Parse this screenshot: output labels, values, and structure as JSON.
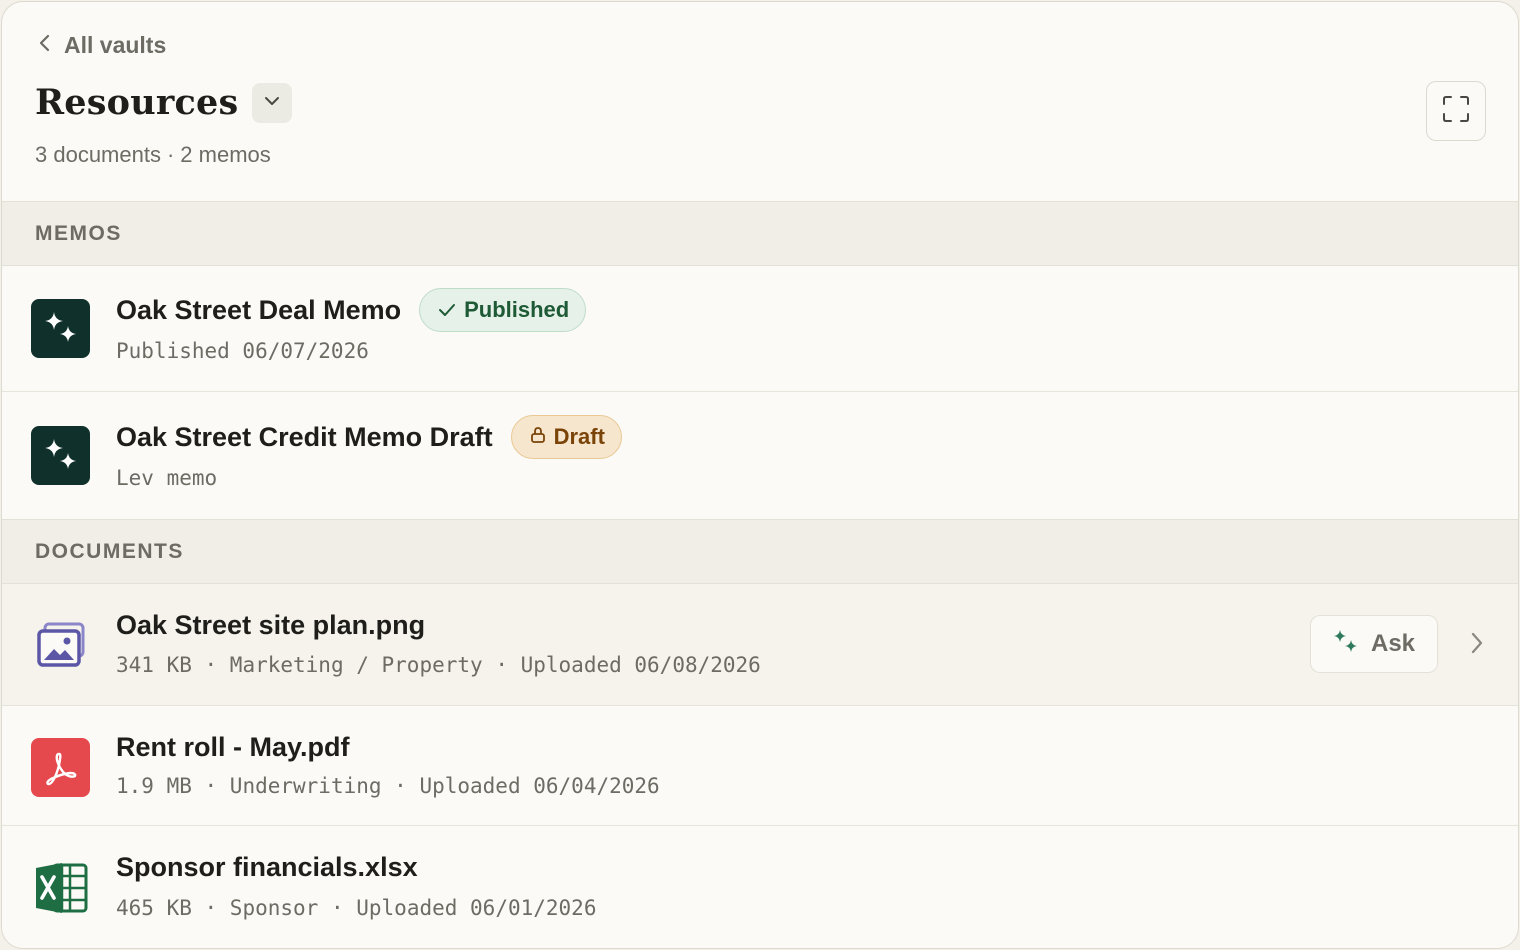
{
  "header": {
    "back_label": "All vaults",
    "title": "Resources",
    "summary_documents": "3 documents",
    "summary_separator": "·",
    "summary_memos": "2 memos"
  },
  "memos_section": {
    "heading": "MEMOS",
    "items": [
      {
        "title": "Oak Street Deal Memo",
        "badge": "Published",
        "badge_icon": "check-icon",
        "subtitle": "Published 06/07/2026"
      },
      {
        "title": "Oak Street Credit Memo Draft",
        "badge": "Draft",
        "badge_icon": "lock-icon",
        "subtitle": "Lev memo"
      }
    ]
  },
  "documents_section": {
    "heading": "DOCUMENTS",
    "items": [
      {
        "title": "Oak Street site plan.png",
        "icon": "image-file-icon",
        "size": "341 KB",
        "category": "Marketing / Property",
        "uploaded": "Uploaded 06/08/2026",
        "ask_label": "Ask"
      },
      {
        "title": "Rent roll - May.pdf",
        "icon": "pdf-file-icon",
        "size": "1.9 MB",
        "category": "Underwriting",
        "uploaded": "Uploaded 06/04/2026"
      },
      {
        "title": "Sponsor financials.xlsx",
        "icon": "excel-file-icon",
        "size": "465 KB",
        "category": "Sponsor",
        "uploaded": "Uploaded 06/01/2026"
      }
    ],
    "meta_separator": " · "
  },
  "colors": {
    "memo_icon_bg": "#10302b",
    "published_badge_text": "#1e5a35",
    "draft_badge_text": "#7a4409",
    "pdf_red": "#e5484d",
    "excel_green": "#1f6e43",
    "image_icon_purple": "#5b57a6"
  }
}
